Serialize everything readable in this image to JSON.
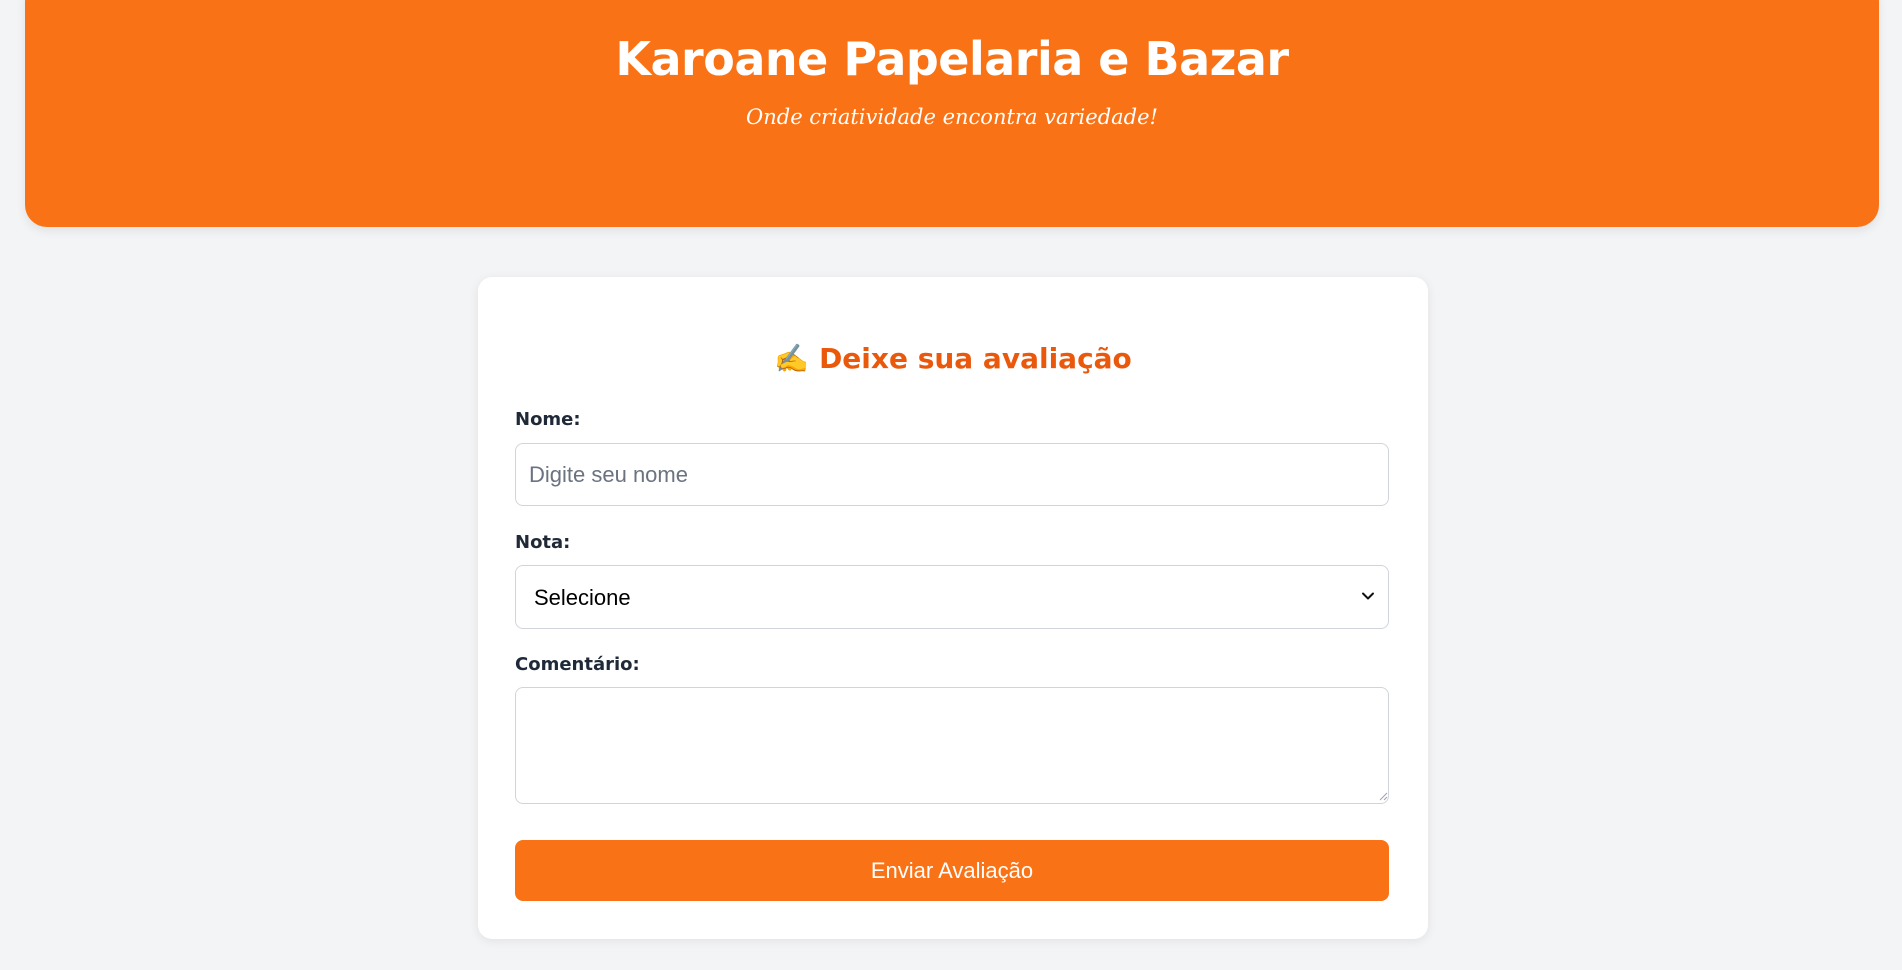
{
  "header": {
    "title": "Karoane Papelaria e Bazar",
    "subtitle": "Onde criatividade encontra variedade!"
  },
  "review_form": {
    "title_icon": "writing-hand-icon",
    "title_emoji": "✍️",
    "title": "Deixe sua avaliação",
    "name_label": "Nome:",
    "name_placeholder": "Digite seu nome",
    "name_value": "",
    "rating_label": "Nota:",
    "rating_selected": "Selecione",
    "comment_label": "Comentário:",
    "comment_value": "",
    "submit_label": "Enviar Avaliação"
  },
  "colors": {
    "brand_orange": "#f97316",
    "title_orange": "#ea580c",
    "background": "#f3f4f6"
  }
}
